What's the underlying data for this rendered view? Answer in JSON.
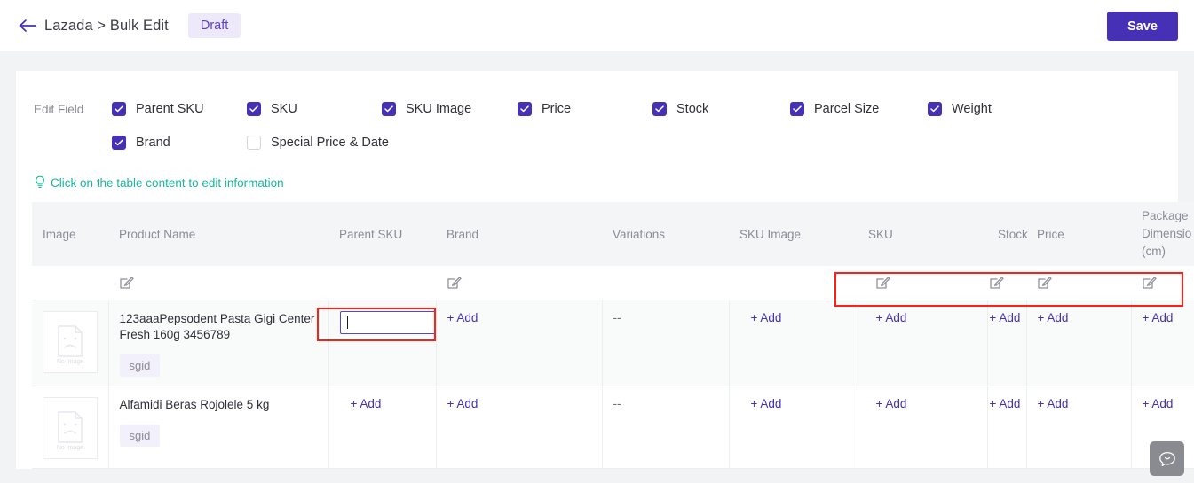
{
  "header": {
    "back_icon": "arrow-left-icon",
    "breadcrumb": "Lazada > Bulk Edit",
    "status_badge": "Draft",
    "save_label": "Save"
  },
  "edit_field": {
    "label": "Edit Field",
    "row1": [
      {
        "label": "Parent SKU",
        "checked": true
      },
      {
        "label": "SKU",
        "checked": true
      },
      {
        "label": "SKU Image",
        "checked": true
      },
      {
        "label": "Price",
        "checked": true
      },
      {
        "label": "Stock",
        "checked": true
      },
      {
        "label": "Parcel Size",
        "checked": true
      },
      {
        "label": "Weight",
        "checked": true
      }
    ],
    "row2": [
      {
        "label": "Brand",
        "checked": true
      },
      {
        "label": "Special Price & Date",
        "checked": false
      }
    ]
  },
  "hint": {
    "icon": "lightbulb-icon",
    "text": "Click on the table content to edit information"
  },
  "table": {
    "columns": [
      "Image",
      "Product Name",
      "Parent SKU",
      "Brand",
      "Variations",
      "SKU Image",
      "SKU",
      "Stock",
      "Price",
      "Package Dimension (cm)"
    ],
    "package_dim_line1": "Package",
    "package_dim_line2": "Dimensio",
    "package_dim_line3": "(cm)",
    "bulk_edit_icons": {
      "product_name": "edit-pencil-icon",
      "brand": "edit-pencil-icon",
      "sku_image": "edit-pencil-icon",
      "sku": "edit-pencil-icon",
      "stock": "edit-pencil-icon",
      "price": "edit-pencil-icon",
      "package": "edit-pencil-icon"
    },
    "add_label": "+ Add",
    "empty_value": "--",
    "image_placeholder": "No Image",
    "rows": [
      {
        "product_name": "123aaaPepsodent Pasta Gigi Center Fresh 160g 3456789",
        "tag": "sgid",
        "parent_sku_value": "",
        "brand": "+ Add",
        "variations": "--",
        "sku_image": "+ Add",
        "sku": "+ Add",
        "stock": "+ Add",
        "price": "+ Add",
        "package": "+ Add"
      },
      {
        "product_name": "Alfamidi Beras Rojolele 5 kg",
        "tag": "sgid",
        "parent_sku_value": "+ Add",
        "brand": "+ Add",
        "variations": "--",
        "sku_image": "+ Add",
        "sku": "+ Add",
        "stock": "+ Add",
        "price": "+ Add",
        "package": "+ Add"
      }
    ]
  },
  "annotations": {
    "icons_box_color": "#ff1f14",
    "input_box_color": "#ff1f14"
  },
  "chat": {
    "icon": "chat-bubble-icon"
  },
  "colors": {
    "accent": "#4630b5",
    "hint": "#18b89b",
    "badge_bg": "#ede9fb"
  }
}
